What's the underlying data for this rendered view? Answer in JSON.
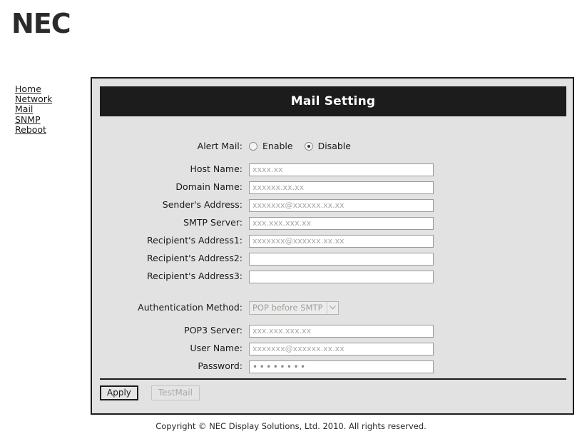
{
  "brand": {
    "logo_text": "NEC"
  },
  "sidebar": {
    "items": [
      {
        "label": "Home"
      },
      {
        "label": "Network"
      },
      {
        "label": "Mail"
      },
      {
        "label": "SNMP"
      },
      {
        "label": "Reboot"
      }
    ]
  },
  "panel": {
    "title": "Mail Setting"
  },
  "form": {
    "alert_mail": {
      "label": "Alert Mail:",
      "options": [
        {
          "label": "Enable",
          "selected": false
        },
        {
          "label": "Disable",
          "selected": true
        }
      ]
    },
    "fields": [
      {
        "label": "Host Name:",
        "value": "",
        "placeholder": "xxxx.xx"
      },
      {
        "label": "Domain Name:",
        "value": "",
        "placeholder": "xxxxxx.xx.xx"
      },
      {
        "label": "Sender's Address:",
        "value": "",
        "placeholder": "xxxxxxx@xxxxxx.xx.xx"
      },
      {
        "label": "SMTP Server:",
        "value": "",
        "placeholder": "xxx.xxx.xxx.xx"
      },
      {
        "label": "Recipient's Address1:",
        "value": "",
        "placeholder": "xxxxxxx@xxxxxx.xx.xx"
      },
      {
        "label": "Recipient's Address2:",
        "value": "",
        "placeholder": ""
      },
      {
        "label": "Recipient's Address3:",
        "value": "",
        "placeholder": ""
      }
    ],
    "auth_method": {
      "label": "Authentication Method:",
      "selected": "POP before SMTP",
      "options": [
        "POP before SMTP"
      ],
      "disabled": true
    },
    "auth_fields": [
      {
        "label": "POP3 Server:",
        "value": "",
        "placeholder": "xxx.xxx.xxx.xx"
      },
      {
        "label": "User Name:",
        "value": "",
        "placeholder": "xxxxxxx@xxxxxx.xx.xx"
      }
    ],
    "password": {
      "label": "Password:",
      "value": "••••••••"
    }
  },
  "buttons": {
    "apply": "Apply",
    "testmail": "TestMail"
  },
  "footer": {
    "copyright": "Copyright © NEC Display Solutions, Ltd. 2010. All rights reserved."
  },
  "colors": {
    "panel_bg": "#e2e2e2",
    "title_bar": "#1c1c1c",
    "page_bg": "#ffffff",
    "border": "#1c1c1c",
    "input_border": "#9a9a9a",
    "placeholder": "#a8a8a8",
    "disabled_text": "#aaaaaa"
  }
}
